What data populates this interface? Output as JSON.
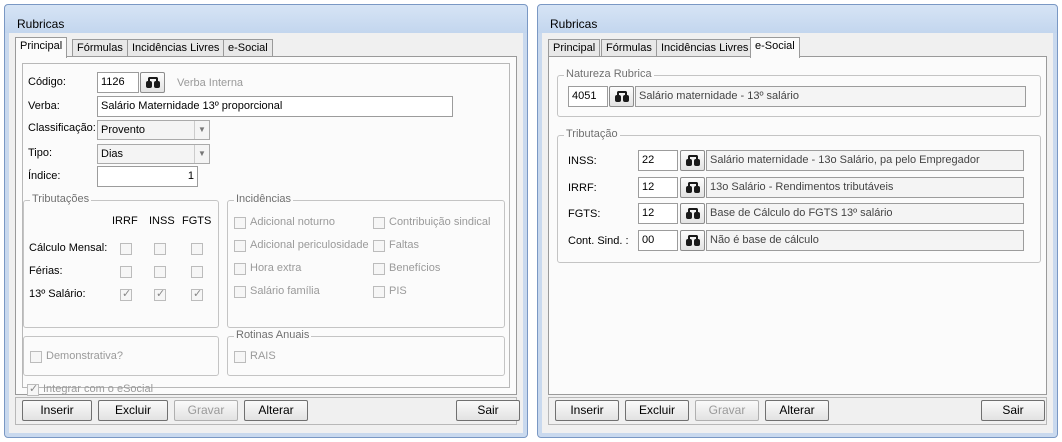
{
  "left_window": {
    "title": "Rubricas",
    "tabs": [
      "Principal",
      "Fórmulas",
      "Incidências Livres",
      "e-Social"
    ],
    "fields": {
      "codigo_label": "Código:",
      "codigo_value": "1126",
      "verba_interna_label": "Verba Interna",
      "verba_label": "Verba:",
      "verba_value": "Salário Maternidade 13º proporcional",
      "classificacao_label": "Classificação:",
      "classificacao_value": "Provento",
      "tipo_label": "Tipo:",
      "tipo_value": "Dias",
      "indice_label": "Índice:",
      "indice_value": "1"
    },
    "tributacoes": {
      "title": "Tributações",
      "columns": [
        "IRRF",
        "INSS",
        "FGTS"
      ],
      "rows": [
        {
          "label": "Cálculo Mensal:",
          "checked": [
            false,
            false,
            false
          ]
        },
        {
          "label": "Férias:",
          "checked": [
            false,
            false,
            false
          ]
        },
        {
          "label": "13º Salário:",
          "checked": [
            true,
            true,
            true
          ]
        }
      ]
    },
    "incidencias": {
      "title": "Incidências",
      "left": [
        "Adicional noturno",
        "Adicional periculosidade",
        "Hora extra",
        "Salário família"
      ],
      "right": [
        "Contribuição sindical",
        "Faltas",
        "Benefícios",
        "PIS"
      ]
    },
    "demonstrativa_label": "Demonstrativa?",
    "rotinas": {
      "title": "Rotinas Anuais",
      "rais_label": "RAIS"
    },
    "integrar_label": "Integrar com o eSocial",
    "buttons": {
      "inserir": "Inserir",
      "excluir": "Excluir",
      "gravar": "Gravar",
      "alterar": "Alterar",
      "sair": "Sair"
    }
  },
  "right_window": {
    "title": "Rubricas",
    "tabs": [
      "Principal",
      "Fórmulas",
      "Incidências Livres",
      "e-Social"
    ],
    "natureza": {
      "title": "Natureza Rubrica",
      "code": "4051",
      "desc": "Salário maternidade - 13º salário"
    },
    "tributacao": {
      "title": "Tributação",
      "rows": [
        {
          "label": "INSS:",
          "code": "22",
          "desc": "Salário maternidade - 13o Salário, pa pelo Empregador"
        },
        {
          "label": "IRRF:",
          "code": "12",
          "desc": "13o Salário - Rendimentos tributáveis"
        },
        {
          "label": "FGTS:",
          "code": "12",
          "desc": "Base de Cálculo do FGTS 13º salário"
        },
        {
          "label": "Cont. Sind. :",
          "code": "00",
          "desc": "Não é base de cálculo"
        }
      ]
    },
    "buttons": {
      "inserir": "Inserir",
      "excluir": "Excluir",
      "gravar": "Gravar",
      "alterar": "Alterar",
      "sair": "Sair"
    }
  }
}
